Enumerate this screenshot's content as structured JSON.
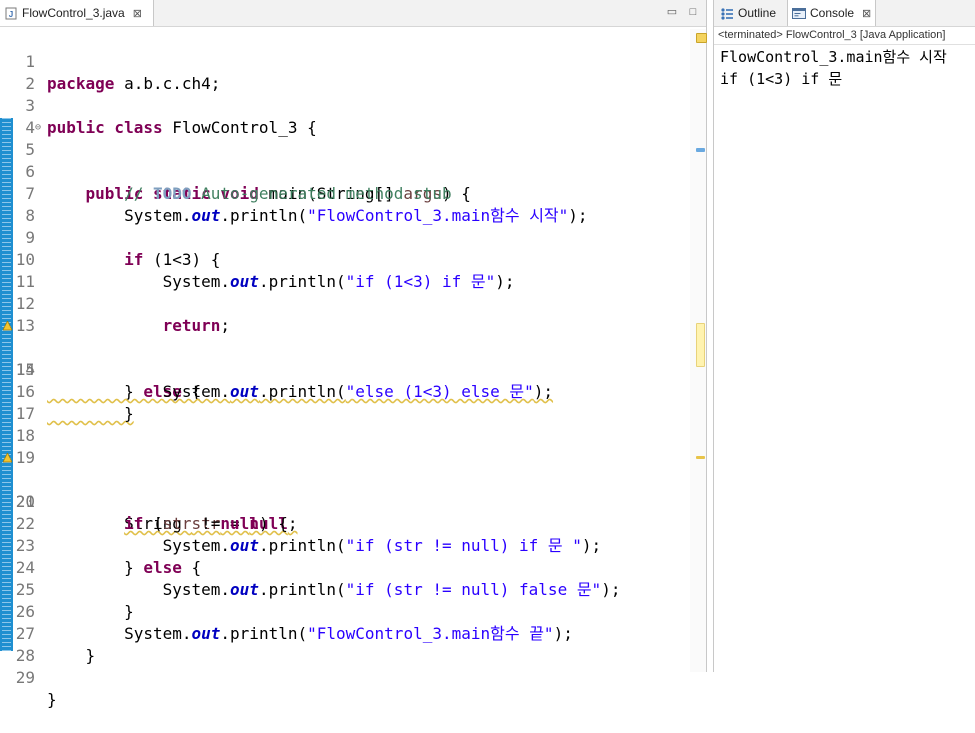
{
  "editor": {
    "tab_label": "FlowControl_3.java",
    "tab_close": "⊠",
    "minimize": "▭",
    "maximize": "□"
  },
  "code_lines": [
    {
      "n": "1",
      "text": "package a.b.c.ch4;"
    },
    {
      "n": "2",
      "text": ""
    },
    {
      "n": "3",
      "text": "public class FlowControl_3 {"
    },
    {
      "n": "4",
      "text": ""
    },
    {
      "n": "5",
      "text": "public static void main(String[] args) {"
    },
    {
      "n": "6",
      "text": "// TODO Auto-generated method stub"
    },
    {
      "n": "7",
      "text": "System.out.println(\"FlowControl_3.main함수 시작\");"
    },
    {
      "n": "8",
      "text": ""
    },
    {
      "n": "9",
      "text": "if (1<3) {"
    },
    {
      "n": "10",
      "text": "System.out.println(\"if (1<3) if 문\");"
    },
    {
      "n": "11",
      "text": ""
    },
    {
      "n": "12",
      "text": "return;"
    },
    {
      "n": "13",
      "text": ""
    },
    {
      "n": "14",
      "text": "} else {"
    },
    {
      "n": "15",
      "text": "System.out.println(\"else (1<3) else 문\");"
    },
    {
      "n": "16",
      "text": "}"
    },
    {
      "n": "17",
      "text": ""
    },
    {
      "n": "18",
      "text": ""
    },
    {
      "n": "19",
      "text": ""
    },
    {
      "n": "20",
      "text": "String str = null;"
    },
    {
      "n": "21",
      "text": "if (str !=null) {"
    },
    {
      "n": "22",
      "text": "System.out.println(\"if (str != null) if 문 \");"
    },
    {
      "n": "23",
      "text": "} else {"
    },
    {
      "n": "24",
      "text": "System.out.println(\"if (str != null) false 문\");"
    },
    {
      "n": "25",
      "text": "}"
    },
    {
      "n": "26",
      "text": "System.out.println(\"FlowControl_3.main함수 끝\");"
    },
    {
      "n": "27",
      "text": "}"
    },
    {
      "n": "28",
      "text": ""
    },
    {
      "n": "29",
      "text": "}"
    }
  ],
  "views": {
    "outline_label": "Outline",
    "console_label": "Console",
    "console_close": "⊠",
    "console_header": "<terminated> FlowControl_3 [Java Application]",
    "console_output": [
      "FlowControl_3.main함수 시작",
      "if (1<3) if 문"
    ]
  },
  "icons": {
    "java_file": "java-file-icon",
    "outline": "outline-icon",
    "console": "console-icon",
    "warning": "warning-icon"
  },
  "colors": {
    "keyword": "#7f0055",
    "string": "#2a00ff",
    "comment": "#3f7f5f",
    "field": "#0000c0",
    "ruler": "#1f8fd0",
    "warning": "#e0c04a"
  }
}
